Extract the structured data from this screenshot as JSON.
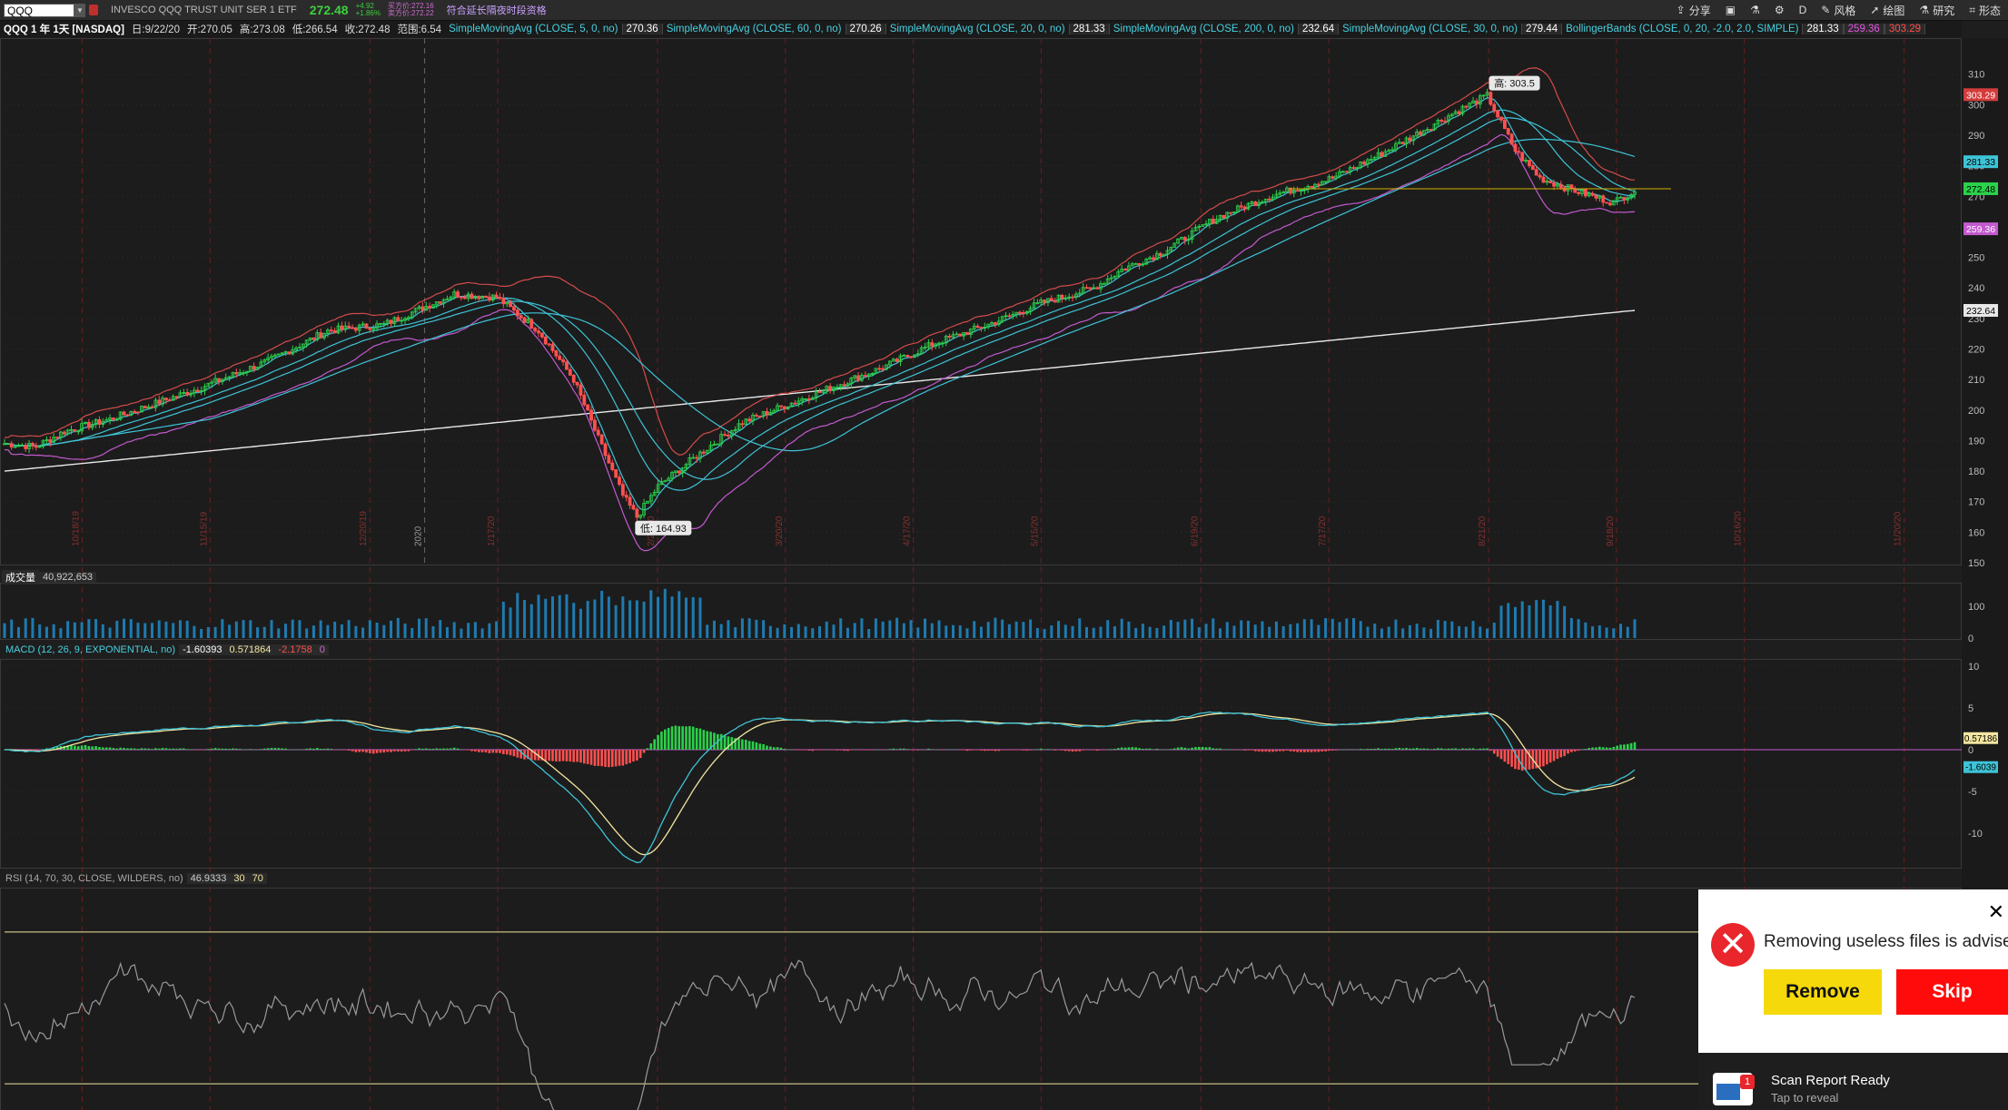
{
  "topbar": {
    "symbol": "QQQ",
    "security_name": "INVESCO QQQ TRUST UNIT SER 1 ETF",
    "last": "272.48",
    "change1": "+4.92",
    "change2": "+1.86%",
    "bid": "买方价:272.16",
    "ask": "卖方价:272.22",
    "ext_hours": "符合延长隔夜时段资格",
    "buttons": {
      "share": "分享",
      "timeframe": "D",
      "style": "风格",
      "draw": "绘图",
      "study": "研究",
      "pattern": "形态"
    }
  },
  "infobar": {
    "title": "QQQ 1 年 1天 [NASDAQ]",
    "date": "日:9/22/20",
    "open": "开:270.05",
    "high": "高:273.08",
    "low": "低:266.54",
    "close": "收:272.48",
    "range": "范围:6.54",
    "studies": [
      {
        "name": "SimpleMovingAvg (CLOSE, 5, 0, no)",
        "value": "270.36"
      },
      {
        "name": "SimpleMovingAvg (CLOSE, 60, 0, no)",
        "value": "270.26"
      },
      {
        "name": "SimpleMovingAvg (CLOSE, 20, 0, no)",
        "value": "281.33"
      },
      {
        "name": "SimpleMovingAvg (CLOSE, 200, 0, no)",
        "value": "232.64"
      },
      {
        "name": "SimpleMovingAvg (CLOSE, 30, 0, no)",
        "value": "279.44"
      }
    ],
    "bollinger": {
      "name": "BollingerBands (CLOSE, 0, 20, -2.0, 2.0, SIMPLE)",
      "mid": "281.33",
      "lower": "259.36",
      "upper": "303.29"
    }
  },
  "price_panel": {
    "y_ticks": [
      "310",
      "300",
      "290",
      "280",
      "270",
      "260",
      "250",
      "240",
      "230",
      "220",
      "210",
      "200",
      "190",
      "180",
      "170",
      "160",
      "150"
    ],
    "x_labels": [
      "10/18/19",
      "11/15/19",
      "12/20/19",
      "1/17/20",
      "2/21/20",
      "3/20/20",
      "4/17/20",
      "5/15/20",
      "6/19/20",
      "7/17/20",
      "8/21/20",
      "9/18/20",
      "10/16/20",
      "11/20/20"
    ],
    "axis_badges": {
      "upper": "303.29",
      "sma20": "281.33",
      "last": "272.48",
      "lower": "259.36",
      "sma200": "232.64"
    },
    "high_label": "高: 303.5",
    "low_label": "低: 164.93",
    "year_label": "2020"
  },
  "volume_panel": {
    "label": "成交量",
    "value": "40,922,653",
    "ticks": [
      "100",
      "0"
    ]
  },
  "macd_panel": {
    "label": "MACD (12, 26, 9, EXPONENTIAL, no)",
    "value": "-1.60393",
    "avg": "0.571864",
    "diff": "-2.1758",
    "zero": "0",
    "ticks": [
      "10",
      "5",
      "0",
      "-5",
      "-10"
    ],
    "badge_avg": "0.57186",
    "badge_value": "-1.6039"
  },
  "rsi_panel": {
    "label": "RSI (14, 70, 30, CLOSE, WILDERS, no)",
    "value": "46.9333",
    "ob": "30",
    "os": "70"
  },
  "popup": {
    "message": "Removing useless files is advised",
    "remove": "Remove",
    "skip": "Skip"
  },
  "notification": {
    "title": "Scan Report Ready",
    "subtitle": "Tap to reveal",
    "badge": "1"
  },
  "chart_data": {
    "type": "line",
    "title": "QQQ 1 年 1天 [NASDAQ]",
    "x_range": [
      "10/1/19",
      "9/22/20"
    ],
    "ylim": [
      150,
      312
    ],
    "series": [
      {
        "name": "Close",
        "x": [
          "10/1/19",
          "11/15/19",
          "12/20/19",
          "1/17/20",
          "2/19/20",
          "3/16/20",
          "3/20/20",
          "4/17/20",
          "5/15/20",
          "6/19/20",
          "7/17/20",
          "8/21/20",
          "9/2/20",
          "9/18/20",
          "9/22/20"
        ],
        "values": [
          190,
          200,
          210,
          223,
          236,
          170,
          165,
          208,
          225,
          245,
          260,
          280,
          303.5,
          268,
          272.48
        ]
      },
      {
        "name": "SMA200",
        "x": [
          "10/1/19",
          "3/20/20",
          "9/22/20"
        ],
        "values": [
          180,
          199,
          232.64
        ]
      }
    ]
  },
  "colors": {
    "up": "#ff5050",
    "down": "#2bd14b",
    "sma_cyan": "#3ec3d6",
    "sma200": "#e8e8e8",
    "bb_red": "#d44b4b",
    "bb_magenta": "#c35acf",
    "vol": "#1e7bb0",
    "last_badge": "#2bd14b"
  }
}
